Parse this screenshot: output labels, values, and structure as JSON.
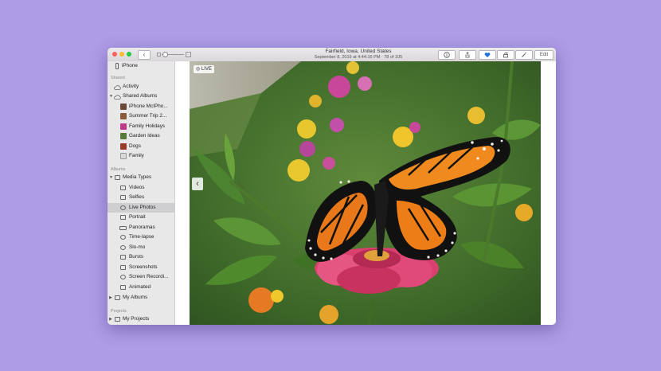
{
  "window": {
    "title": "Fairfield, Iowa, United States",
    "subtitle": "September 8, 2019 at 4:44:16 PM  ·  78 of 105"
  },
  "toolbar": {
    "back_icon": "chevron-left-icon",
    "info_icon": "info-icon",
    "share_icon": "share-icon",
    "favorite_icon": "heart-icon",
    "rotate_icon": "rotate-icon",
    "enhance_icon": "magic-wand-icon",
    "edit_label": "Edit",
    "favorite_color": "#1f6fe0"
  },
  "sidebar": {
    "top_item": "iPhone",
    "shared_header": "Shared",
    "activity": "Activity",
    "shared_albums": "Shared Albums",
    "shared_album_items": [
      "iPhone McIPho...",
      "Summer Trip 2...",
      "Family Holidays",
      "Garden Ideas",
      "Dogs",
      "Family"
    ],
    "albums_header": "Albums",
    "media_types": "Media Types",
    "media_items": [
      "Videos",
      "Selfies",
      "Live Photos",
      "Portrait",
      "Panoramas",
      "Time-lapse",
      "Slo-mo",
      "Bursts",
      "Screenshots",
      "Screen Recordi...",
      "Animated"
    ],
    "selected_item": "Live Photos",
    "my_albums": "My Albums",
    "projects_header": "Projects",
    "my_projects": "My Projects"
  },
  "photo": {
    "badge": "LIVE",
    "prev_arrow": "‹"
  },
  "colors": {
    "background": "#ad9ce6",
    "sidebar": "#e9e8e9",
    "selected_row": "#cfcfd2"
  }
}
